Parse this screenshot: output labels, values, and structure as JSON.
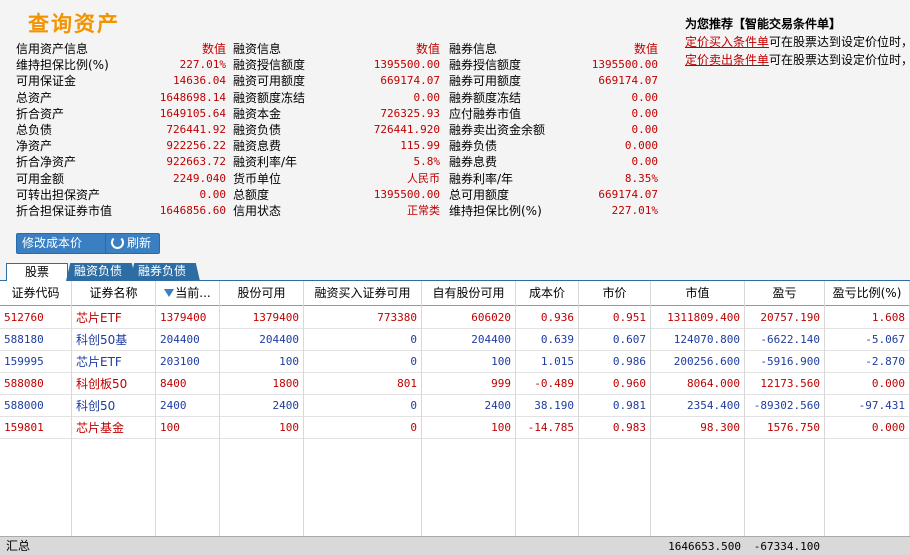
{
  "title": "查询资产",
  "info_rows": [
    {
      "l1": "信用资产信息",
      "v1": "数值",
      "l2": "融资信息",
      "v2": "数值",
      "l3": "融券信息",
      "v3": "数值",
      "header": true
    },
    {
      "l1": "维持担保比例(%)",
      "v1": "227.01%",
      "l2": "融资授信额度",
      "v2": "1395500.00",
      "l3": "融券授信额度",
      "v3": "1395500.00"
    },
    {
      "l1": "可用保证金",
      "v1": "14636.04",
      "l2": "融资可用额度",
      "v2": "669174.07",
      "l3": "融券可用额度",
      "v3": "669174.07"
    },
    {
      "l1": "总资产",
      "v1": "1648698.14",
      "l2": "融资额度冻结",
      "v2": "0.00",
      "l3": "融券额度冻结",
      "v3": "0.00"
    },
    {
      "l1": "折合资产",
      "v1": "1649105.64",
      "l2": "融资本金",
      "v2": "726325.93",
      "l3": "应付融券市值",
      "v3": "0.00"
    },
    {
      "l1": "总负债",
      "v1": "726441.92",
      "l2": "融资负债",
      "v2": "726441.920",
      "l3": "融券卖出资金余额",
      "v3": "0.00"
    },
    {
      "l1": "净资产",
      "v1": "922256.22",
      "l2": "融资息费",
      "v2": "115.99",
      "l3": "融券负债",
      "v3": "0.000"
    },
    {
      "l1": "折合净资产",
      "v1": "922663.72",
      "l2": "融资利率/年",
      "v2": "5.8%",
      "l3": "融券息费",
      "v3": "0.00"
    },
    {
      "l1": "可用金额",
      "v1": "2249.040",
      "l2": "货币单位",
      "v2": "人民币",
      "l3": "融券利率/年",
      "v3": "8.35%"
    },
    {
      "l1": "可转出担保资产",
      "v1": "0.00",
      "l2": "总额度",
      "v2": "1395500.00",
      "l3": "总可用额度",
      "v3": "669174.07"
    },
    {
      "l1": "折合担保证券市值",
      "v1": "1646856.60",
      "l2": "信用状态",
      "v2": "正常类",
      "l3": "维持担保比例(%)",
      "v3": "227.01%"
    }
  ],
  "recommend": {
    "title": "为您推荐【智能交易条件单】",
    "line1_link": "定价买入条件单",
    "line1_text": "可在股票达到设定价位时，",
    "line2_link": "定价卖出条件单",
    "line2_text": "可在股票达到设定价位时，"
  },
  "buttons": {
    "modify_cost": "修改成本价",
    "refresh": "刷新"
  },
  "tabs": [
    "股票",
    "融资负债",
    "融券负债"
  ],
  "columns": [
    "证券代码",
    "证券名称",
    "当前...",
    "股份可用",
    "融资买入证券可用",
    "自有股份可用",
    "成本价",
    "市价",
    "市值",
    "盈亏",
    "盈亏比例(%)"
  ],
  "rows": [
    {
      "code": "512760",
      "name": "芯片ETF",
      "cur": "1379400",
      "avail": "1379400",
      "margin": "773380",
      "own": "606020",
      "cost": "0.936",
      "price": "0.951",
      "mv": "1311809.400",
      "pl": "20757.190",
      "plr": "1.608",
      "color": "red"
    },
    {
      "code": "588180",
      "name": "科创50基",
      "cur": "204400",
      "avail": "204400",
      "margin": "0",
      "own": "204400",
      "cost": "0.639",
      "price": "0.607",
      "mv": "124070.800",
      "pl": "-6622.140",
      "plr": "-5.067",
      "color": "blue"
    },
    {
      "code": "159995",
      "name": "芯片ETF",
      "cur": "203100",
      "avail": "100",
      "margin": "0",
      "own": "100",
      "cost": "1.015",
      "price": "0.986",
      "mv": "200256.600",
      "pl": "-5916.900",
      "plr": "-2.870",
      "color": "blue"
    },
    {
      "code": "588080",
      "name": "科创板50",
      "cur": "8400",
      "avail": "1800",
      "margin": "801",
      "own": "999",
      "cost": "-0.489",
      "price": "0.960",
      "mv": "8064.000",
      "pl": "12173.560",
      "plr": "0.000",
      "color": "red"
    },
    {
      "code": "588000",
      "name": "科创50",
      "cur": "2400",
      "avail": "2400",
      "margin": "0",
      "own": "2400",
      "cost": "38.190",
      "price": "0.981",
      "mv": "2354.400",
      "pl": "-89302.560",
      "plr": "-97.431",
      "color": "blue"
    },
    {
      "code": "159801",
      "name": "芯片基金",
      "cur": "100",
      "avail": "100",
      "margin": "0",
      "own": "100",
      "cost": "-14.785",
      "price": "0.983",
      "mv": "98.300",
      "pl": "1576.750",
      "plr": "0.000",
      "color": "red"
    }
  ],
  "summary": {
    "label": "汇总",
    "mv": "1646653.500",
    "pl": "-67334.100"
  }
}
